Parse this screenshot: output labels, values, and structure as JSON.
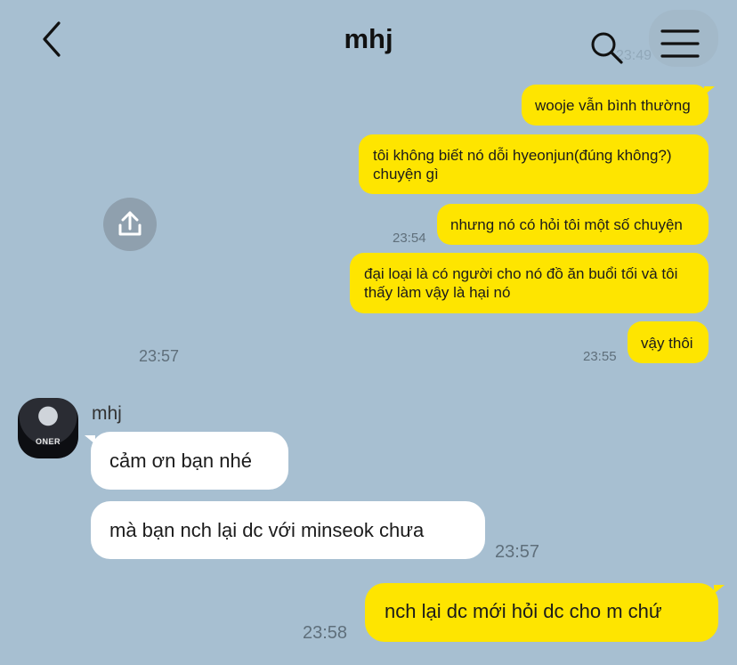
{
  "header": {
    "title": "mhj",
    "ghost_time": "23:49"
  },
  "share_icon": "upload-icon",
  "messages": {
    "m1": "wooje vẫn bình thường",
    "m2": "tôi không biết nó dỗi hyeonjun(đúng không?) chuyện gì",
    "m3": "nhưng nó có hỏi tôi một số chuyện",
    "m3_time": "23:54",
    "m4": "đại loại là có người cho nó đồ ăn buổi tối và tôi thấy làm vậy là hại nó",
    "m5": "vậy thôi",
    "m5_time": "23:55",
    "left_time": "23:57",
    "sender": "mhj",
    "avatar_text": "ONER",
    "r1": "cảm ơn bạn nhé",
    "r2": "mà bạn nch lại dc với minseok chưa",
    "r2_time": "23:57",
    "m6": "nch lại dc mới hỏi dc cho m chứ",
    "m6_time": "23:58"
  },
  "colors": {
    "background": "#a7bfd1",
    "outgoing_bubble": "#fee500",
    "incoming_bubble": "#ffffff"
  }
}
